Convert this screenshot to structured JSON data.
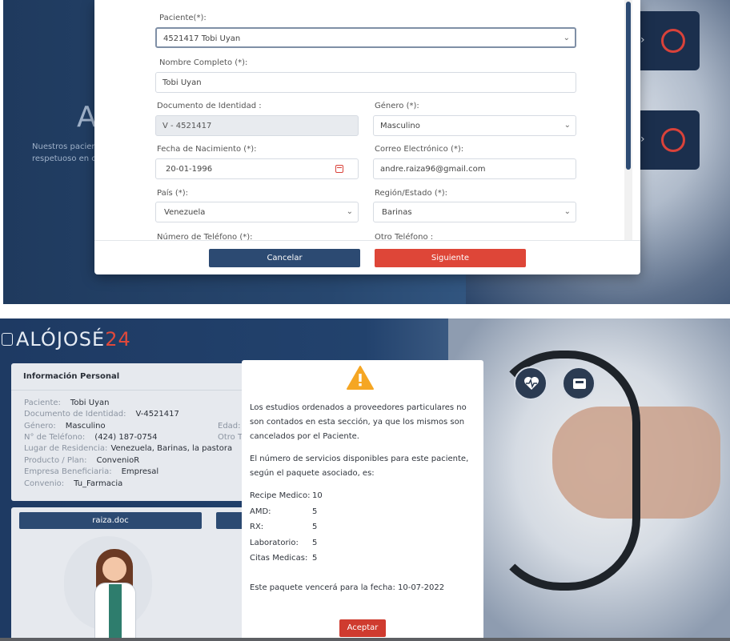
{
  "top": {
    "hero_letters": "Al",
    "hero_text_line1": "Nuestros pacien",
    "hero_text_line2": "respetuoso en cu",
    "card_sub": "a",
    "form": {
      "paciente_label": "Paciente(*):",
      "paciente_value": "4521417 Tobi Uyan",
      "nombre_label": "Nombre Completo (*):",
      "nombre_value": "Tobi Uyan",
      "documento_label": "Documento de Identidad :",
      "documento_value": "V - 4521417",
      "genero_label": "Género (*):",
      "genero_value": "Masculino",
      "fecha_label": "Fecha de Nacimiento (*):",
      "fecha_value": "20-01-1996",
      "correo_label": "Correo Electrónico (*):",
      "correo_value": "andre.raiza96@gmail.com",
      "pais_label": "País (*):",
      "pais_value": "Venezuela",
      "region_label": "Región/Estado (*):",
      "region_value": "Barinas",
      "telefono_label": "Número de Teléfono (*):",
      "otro_telefono_label": "Otro Teléfono :"
    },
    "buttons": {
      "cancel": "Cancelar",
      "next": "Siguiente"
    }
  },
  "bottom": {
    "logo_main": "ALÓJOSÉ",
    "logo_accent": "24",
    "info": {
      "title": "Información Personal",
      "rows": [
        {
          "k": "Paciente:",
          "v": "Tobi Uyan"
        },
        {
          "k": "Documento de Identidad:",
          "v": "V-4521417"
        },
        {
          "k": "Género:",
          "v": "Masculino"
        },
        {
          "k": "N° de Teléfono:",
          "v": "(424) 187-0754"
        },
        {
          "k": "Lugar de Residencia:",
          "v": "Venezuela, Barinas, la pastora"
        },
        {
          "k": "Producto / Plan:",
          "v": "ConvenioR"
        },
        {
          "k": "Empresa Beneficiaria:",
          "v": "Empresal"
        },
        {
          "k": "Convenio:",
          "v": "Tu_Farmacia"
        }
      ],
      "side_edad": "Edad:",
      "side_otro": "Otro T"
    },
    "doc_button": "raiza.doc",
    "modal": {
      "text1": "Los estudios ordenados a proveedores particulares no son contados en esta sección, ya que los mismos son cancelados por el Paciente.",
      "text2": "El número de servicios disponibles para este paciente, según el paquete asociado, es:",
      "services": [
        {
          "k": "Recipe Medico:",
          "v": "10"
        },
        {
          "k": "AMD:",
          "v": "5"
        },
        {
          "k": "RX:",
          "v": "5"
        },
        {
          "k": "Laboratorio:",
          "v": "5"
        },
        {
          "k": "Citas Medicas:",
          "v": "5"
        }
      ],
      "expiry": "Este paquete vencerá para la fecha: 10-07-2022",
      "accept": "Aceptar"
    },
    "colors": {
      "brand_blue": "#2c4a72",
      "brand_red": "#de4638",
      "warning": "#f5a623"
    }
  }
}
